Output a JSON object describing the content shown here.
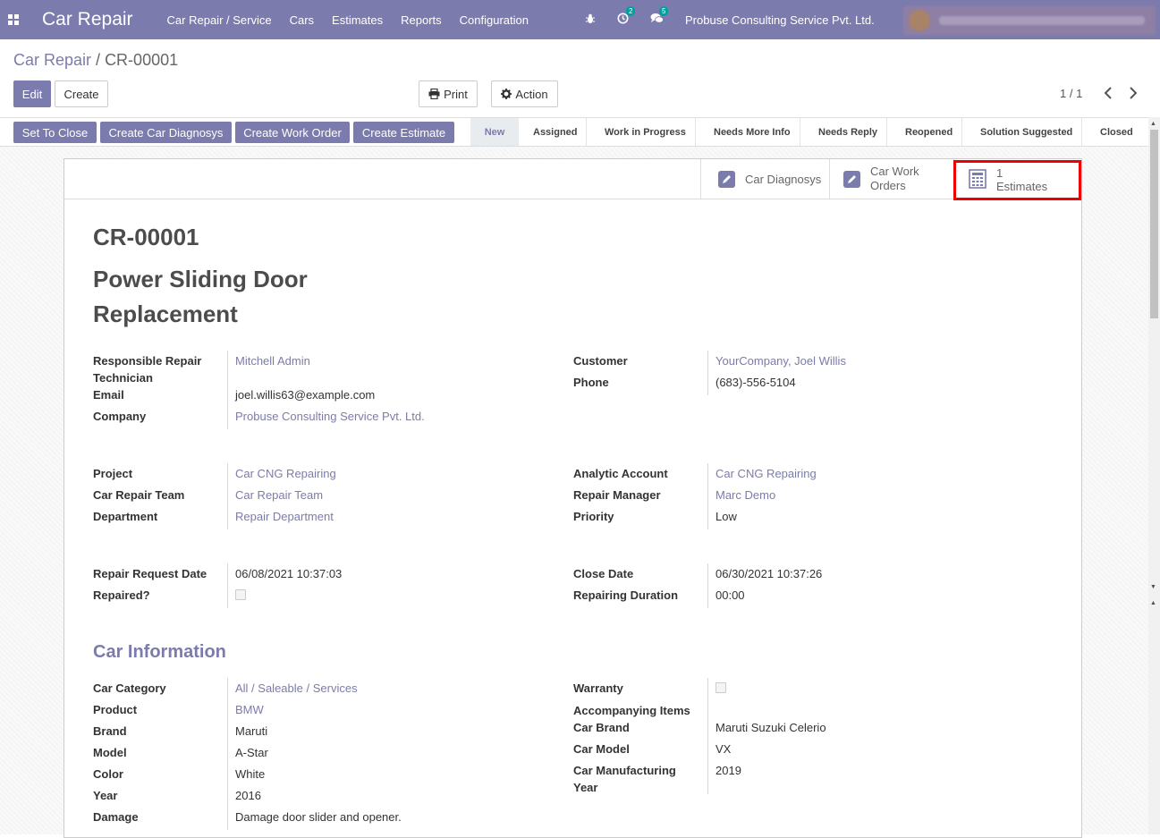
{
  "navbar": {
    "brand": "Car Repair",
    "menu": [
      "Car Repair / Service",
      "Cars",
      "Estimates",
      "Reports",
      "Configuration"
    ],
    "activity_count": "2",
    "messages_count": "5",
    "company": "Probuse Consulting Service Pvt. Ltd."
  },
  "breadcrumb": {
    "parent": "Car Repair",
    "current": "CR-00001"
  },
  "controls": {
    "edit": "Edit",
    "create": "Create",
    "print": "Print",
    "action": "Action",
    "pager": "1 / 1"
  },
  "header_buttons": [
    "Set To Close",
    "Create Car Diagnosys",
    "Create Work Order",
    "Create Estimate"
  ],
  "stages": [
    "New",
    "Assigned",
    "Work in Progress",
    "Needs More Info",
    "Needs Reply",
    "Reopened",
    "Solution Suggested",
    "Closed"
  ],
  "active_stage": "New",
  "smart_buttons": {
    "diagnosys": "Car Diagnosys",
    "work_orders_1": "Car Work",
    "work_orders_2": "Orders",
    "estimates_count": "1",
    "estimates_label": "Estimates"
  },
  "record": {
    "code": "CR-00001",
    "name_line1": "Power Sliding Door",
    "name_line2": "Replacement"
  },
  "group1": {
    "responsible_label_1": "Responsible Repair",
    "responsible_label_2": "Technician",
    "responsible": "Mitchell Admin",
    "email_label": "Email",
    "email": "joel.willis63@example.com",
    "company_label": "Company",
    "company": "Probuse Consulting Service Pvt. Ltd.",
    "customer_label": "Customer",
    "customer": "YourCompany, Joel Willis",
    "phone_label": "Phone",
    "phone": "(683)-556-5104"
  },
  "group2": {
    "project_label": "Project",
    "project": "Car CNG Repairing",
    "team_label": "Car Repair Team",
    "team": "Car Repair Team",
    "department_label": "Department",
    "department": "Repair Department",
    "analytic_label": "Analytic Account",
    "analytic": "Car CNG Repairing",
    "manager_label": "Repair Manager",
    "manager": "Marc Demo",
    "priority_label": "Priority",
    "priority": "Low"
  },
  "group3": {
    "request_date_label": "Repair Request Date",
    "request_date": "06/08/2021 10:37:03",
    "repaired_label": "Repaired?",
    "close_date_label": "Close Date",
    "close_date": "06/30/2021 10:37:26",
    "duration_label": "Repairing Duration",
    "duration": "00:00"
  },
  "car_info": {
    "title": "Car Information",
    "category_label": "Car Category",
    "category": "All / Saleable / Services",
    "product_label": "Product",
    "product": "BMW",
    "brand_label": "Brand",
    "brand": "Maruti",
    "model_label": "Model",
    "model": "A-Star",
    "color_label": "Color",
    "color": "White",
    "year_label": "Year",
    "year": "2016",
    "damage_label": "Damage",
    "damage": "Damage door slider and opener.",
    "warranty_label": "Warranty",
    "accompanying_label": "Accompanying Items",
    "car_brand_label": "Car Brand",
    "car_brand": "Maruti Suzuki Celerio",
    "car_model_label": "Car Model",
    "car_model": "VX",
    "mfg_label_1": "Car Manufacturing",
    "mfg_label_2": "Year",
    "mfg_year": "2019"
  }
}
